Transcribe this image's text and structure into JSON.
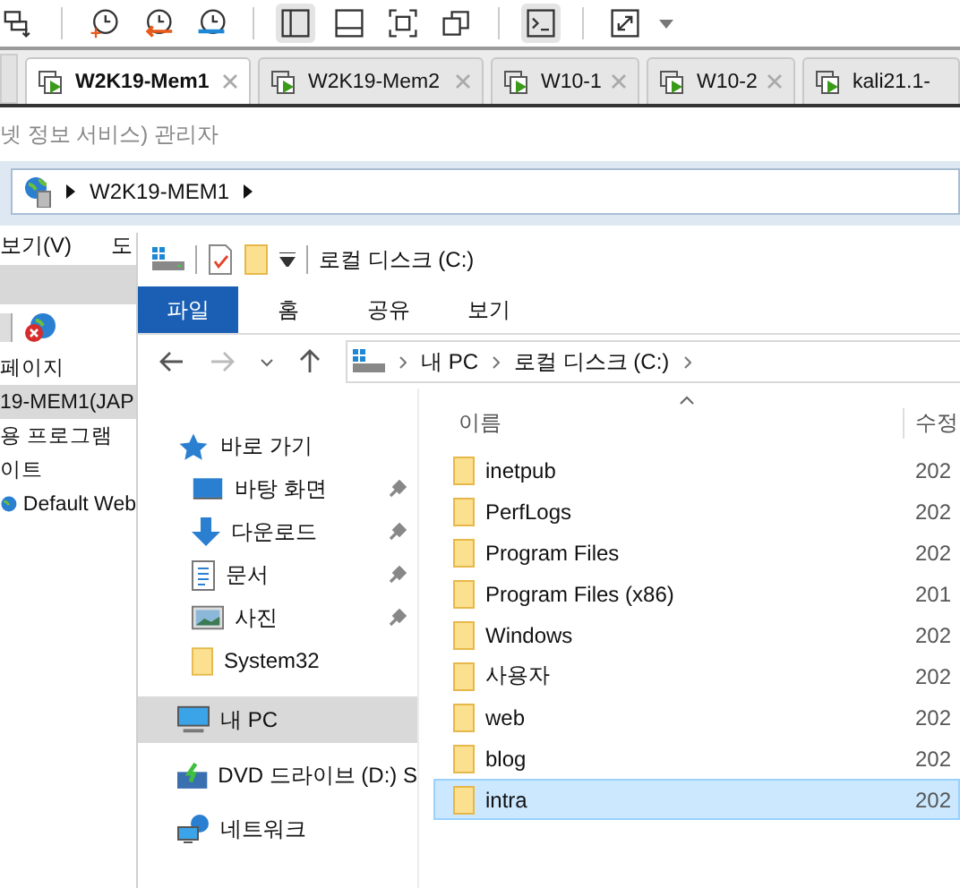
{
  "toolbar": [
    {
      "kind": "send-keys",
      "pressed": false
    },
    {
      "kind": "snapshot-take",
      "pressed": false
    },
    {
      "kind": "snapshot-revert",
      "pressed": false
    },
    {
      "kind": "snapshot-manage",
      "pressed": false
    },
    {
      "kind": "layout-sidebar",
      "pressed": true
    },
    {
      "kind": "layout-bottom",
      "pressed": false
    },
    {
      "kind": "fit",
      "pressed": false
    },
    {
      "kind": "windows",
      "pressed": false
    },
    {
      "kind": "console",
      "pressed": true
    },
    {
      "kind": "fullscreen",
      "pressed": false
    }
  ],
  "vm_tabs": [
    {
      "label": "W2K19-Mem1",
      "selected": true
    },
    {
      "label": "W2K19-Mem2",
      "selected": false
    },
    {
      "label": "W10-1",
      "selected": false
    },
    {
      "label": "W10-2",
      "selected": false
    },
    {
      "label": "kali21.1-",
      "selected": false
    }
  ],
  "background_window": {
    "title": "넷 정보 서비스) 관리자",
    "address": [
      "W2K19-MEM1"
    ],
    "menu": [
      "보기(V)",
      "도"
    ],
    "tree": [
      {
        "label": "페이지",
        "selected": false
      },
      {
        "label": "19-MEM1(JAP",
        "selected": true
      },
      {
        "label": "용 프로그램",
        "selected": false
      },
      {
        "label": "이트",
        "selected": false,
        "children": [
          {
            "label": "Default Web",
            "selected": false
          }
        ]
      }
    ]
  },
  "explorer": {
    "title": "로컬 디스크 (C:)",
    "ribbon_tabs": [
      {
        "label": "파일",
        "selected": true
      },
      {
        "label": "홈",
        "selected": false
      },
      {
        "label": "공유",
        "selected": false
      },
      {
        "label": "보기",
        "selected": false
      }
    ],
    "breadcrumb": [
      "내 PC",
      "로컬 디스크 (C:)"
    ],
    "nav": [
      {
        "label": "바로 가기",
        "kind": "star",
        "selected": false,
        "children": [
          {
            "label": "바탕 화면",
            "kind": "desktop",
            "pinned": true,
            "selected": false
          },
          {
            "label": "다운로드",
            "kind": "download",
            "pinned": true,
            "selected": false
          },
          {
            "label": "문서",
            "kind": "document",
            "pinned": true,
            "selected": false
          },
          {
            "label": "사진",
            "kind": "photo",
            "pinned": true,
            "selected": false
          },
          {
            "label": "System32",
            "kind": "folder",
            "pinned": false,
            "selected": false
          }
        ]
      },
      {
        "label": "내 PC",
        "kind": "pc",
        "selected": true
      },
      {
        "label": "DVD 드라이브 (D:) S",
        "kind": "dvd",
        "selected": false
      },
      {
        "label": "네트워크",
        "kind": "network",
        "selected": false
      }
    ],
    "columns": [
      "이름",
      "수정"
    ],
    "files": [
      {
        "name": "inetpub",
        "modified": "202",
        "selected": false
      },
      {
        "name": "PerfLogs",
        "modified": "202",
        "selected": false
      },
      {
        "name": "Program Files",
        "modified": "202",
        "selected": false
      },
      {
        "name": "Program Files (x86)",
        "modified": "201",
        "selected": false
      },
      {
        "name": "Windows",
        "modified": "202",
        "selected": false
      },
      {
        "name": "사용자",
        "modified": "202",
        "selected": false
      },
      {
        "name": "web",
        "modified": "202",
        "selected": false
      },
      {
        "name": "blog",
        "modified": "202",
        "selected": false
      },
      {
        "name": "intra",
        "modified": "202",
        "selected": true
      }
    ]
  }
}
